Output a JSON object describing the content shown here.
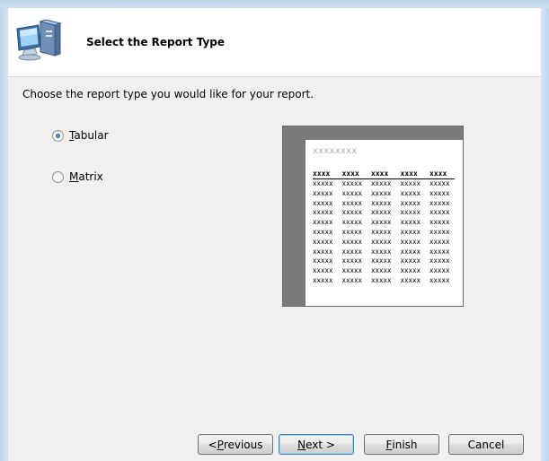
{
  "header": {
    "title": "Select the Report Type",
    "icon": "computer-monitor-icon"
  },
  "instruction": "Choose the report type you would like for your report.",
  "report_types": [
    {
      "label": "Tabular",
      "mnemonic": "T",
      "rest": "abular",
      "selected": true
    },
    {
      "label": "Matrix",
      "mnemonic": "M",
      "rest": "atrix",
      "selected": false
    }
  ],
  "preview": {
    "title": "xxxxxxxx",
    "header_cells": [
      "xxxx",
      "xxxx",
      "xxxx",
      "xxxx",
      "xxxx"
    ],
    "cell_text": "xxxxx",
    "row_count": 11
  },
  "buttons": {
    "previous": {
      "mnemonic": "P",
      "prefix": "< ",
      "rest": "revious"
    },
    "next": {
      "mnemonic": "N",
      "rest": "ext >"
    },
    "finish": {
      "mnemonic": "F",
      "rest": "inish"
    },
    "cancel": {
      "label": "Cancel"
    }
  }
}
